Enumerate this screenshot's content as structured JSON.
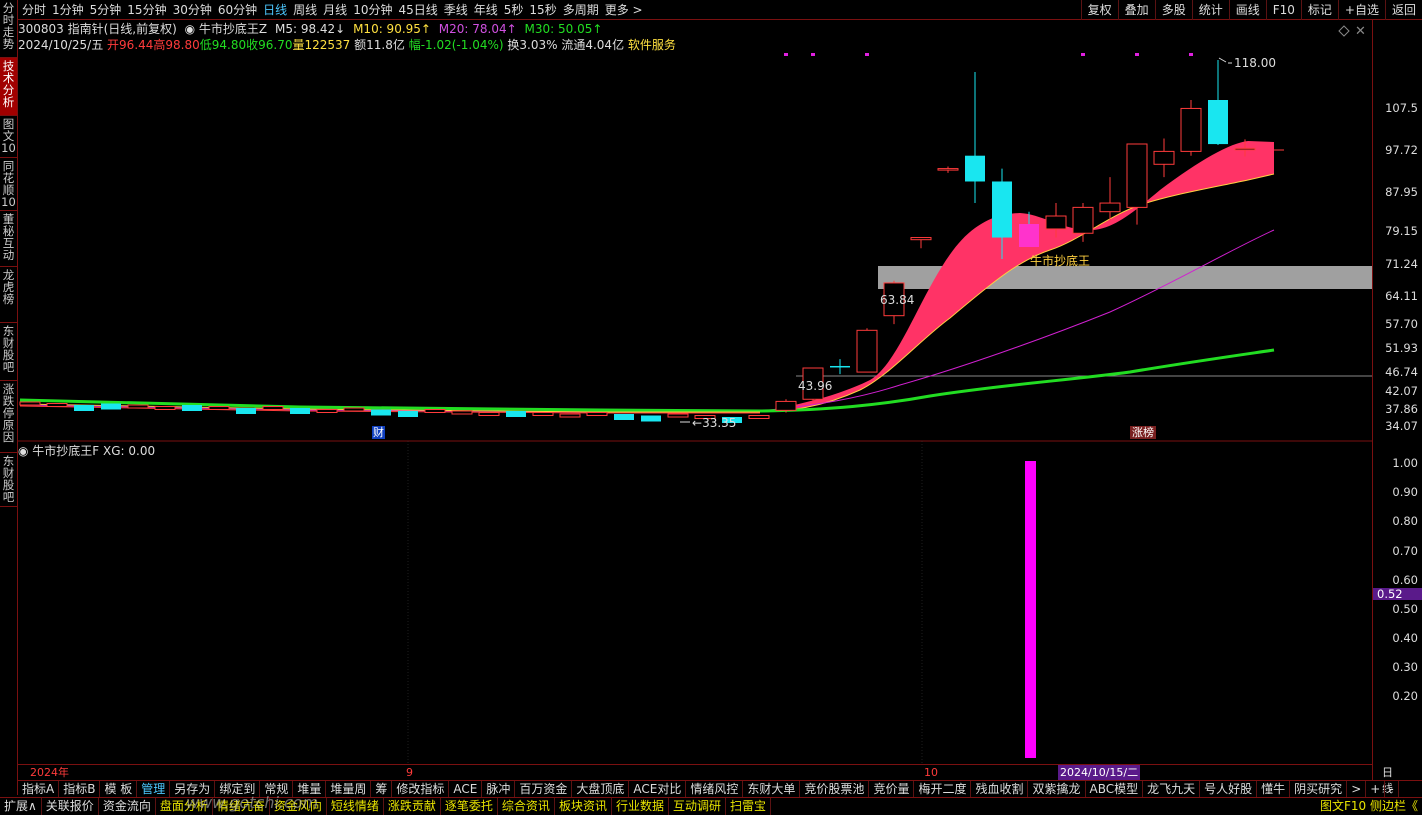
{
  "sidebar": [
    {
      "label": "分时走势",
      "active": false
    },
    {
      "label": "技术分析",
      "active": true
    },
    {
      "label": "图文10",
      "active": false
    },
    {
      "label": "同花顺10",
      "active": false
    },
    {
      "label": "董秘互动",
      "active": false
    },
    {
      "label": "龙虎榜",
      "active": false
    },
    {
      "label": "东财股吧",
      "active": false
    },
    {
      "label": "涨跌停原因",
      "active": false
    },
    {
      "label": "东财股吧",
      "active": false
    }
  ],
  "periods": [
    "分时",
    "1分钟",
    "5分钟",
    "15分钟",
    "30分钟",
    "60分钟",
    "日线",
    "周线",
    "月线",
    "10分钟",
    "45日线",
    "季线",
    "年线",
    "5秒",
    "15秒",
    "多周期",
    "更多 >"
  ],
  "active_period": "日线",
  "right_buttons": [
    "复权",
    "叠加",
    "多股",
    "统计",
    "画线",
    "F10",
    "标记",
    "+自选",
    "返回"
  ],
  "info": {
    "code_name": "300803 指南针(日线,前复权)",
    "indicator": "◉ 牛市抄底王Z",
    "m5": "M5: 98.42↓",
    "m10": "M10: 90.95↑",
    "m20": "M20: 78.04↑",
    "m30": "M30: 50.05↑",
    "date": "2024/10/25/五",
    "open": "开96.44",
    "high": "高98.80",
    "low": "低94.80",
    "close": "收96.70",
    "volume": "量122537",
    "amount": "额11.8亿",
    "change": "幅-1.02(-1.04%)",
    "turnover": "换3.03%",
    "float": "流通4.04亿",
    "sector": "软件服务"
  },
  "price_axis": [
    "107.5",
    "97.72",
    "87.95",
    "79.15",
    "71.24",
    "64.11",
    "57.70",
    "51.93",
    "46.74",
    "42.07",
    "37.86",
    "34.07"
  ],
  "annotations": {
    "high": "118.00",
    "low": "33.35",
    "p6384": "63.84",
    "p4396": "43.96",
    "signal": "牛市抄底王",
    "finance": "财",
    "limit": "涨榜"
  },
  "sub_header": "◉ 牛市抄底王F  XG: 0.00",
  "sub_axis": [
    "1.00",
    "0.90",
    "0.80",
    "0.70",
    "0.60",
    "0.50",
    "0.40",
    "0.30",
    "0.20"
  ],
  "sub_current": "0.52",
  "x_axis": {
    "year": "2024年",
    "m9": "9",
    "m10": "10",
    "cursor": "2024/10/15/二",
    "period": "日线"
  },
  "tabs": [
    "指标A",
    "指标B",
    "模 板",
    "管理",
    "另存为",
    "绑定到",
    "常规",
    "堆量",
    "堆量周",
    "筹",
    "修改指标",
    "ACE",
    "脉冲",
    "百万资金",
    "大盘顶底",
    "ACE对比",
    "情绪风控",
    "东财大单",
    "竞价股票池",
    "竞价量",
    "梅开二度",
    "残血收割",
    "双紫擒龙",
    "ABC模型",
    "龙飞九天",
    "号人好股",
    "懂牛",
    "阴买研究",
    ">",
    "+",
    "-"
  ],
  "active_tab": "管理",
  "bottom": [
    "扩展∧",
    "关联报价",
    "资金流向",
    "盘面分析",
    "情绪亢奋",
    "资金风向",
    "短线情绪",
    "涨跌贡献",
    "逐笔委托",
    "综合资讯",
    "板块资讯",
    "行业数据",
    "互动调研",
    "扫雷宝"
  ],
  "bottom_right": "图文F10 侧边栏《",
  "watermark": "www.gotchi.com",
  "colors": {
    "up": "#ff3b3b",
    "down": "#19e6f0",
    "ribbon": "#ff3366",
    "ma_green": "#22dd22",
    "ma_purple": "#d020d0",
    "signal_bar": "#ff00ff",
    "accent": "#4cc8ff"
  },
  "chart_data": {
    "type": "candlestick",
    "candles": [
      {
        "date": "2024-09-25",
        "open": 36.0,
        "high": 38.5,
        "low": 35.5,
        "close": 38.0
      },
      {
        "date": "2024-09-26",
        "open": 38.5,
        "high": 46.0,
        "low": 38.0,
        "close": 46.0
      },
      {
        "date": "2024-09-27",
        "open": 46.5,
        "high": 48.0,
        "low": 44.5,
        "close": 46.2
      },
      {
        "date": "2024-09-30",
        "open": 45.0,
        "high": 55.0,
        "low": 45.0,
        "close": 54.5
      },
      {
        "date": "2024-10-08",
        "open": 58.0,
        "high": 66.0,
        "low": 56.0,
        "close": 65.5
      },
      {
        "date": "2024-10-09",
        "open": 75.5,
        "high": 76.0,
        "low": 73.5,
        "close": 76.0
      },
      {
        "date": "2024-10-10",
        "open": 92.0,
        "high": 92.5,
        "low": 91.0,
        "close": 92.0
      },
      {
        "date": "2024-10-11",
        "open": 95.0,
        "high": 115.0,
        "low": 84.0,
        "close": 89.0
      },
      {
        "date": "2024-10-14",
        "open": 89.0,
        "high": 92.0,
        "low": 71.0,
        "close": 76.0
      },
      {
        "date": "2024-10-15",
        "open": 78.0,
        "high": 82.0,
        "low": 74.0,
        "close": 76.0
      },
      {
        "date": "2024-10-16",
        "open": 78.0,
        "high": 84.0,
        "low": 76.0,
        "close": 81.0
      },
      {
        "date": "2024-10-17",
        "open": 77.0,
        "high": 84.0,
        "low": 75.0,
        "close": 83.0
      },
      {
        "date": "2024-10-18",
        "open": 82.0,
        "high": 90.0,
        "low": 80.0,
        "close": 84.0
      },
      {
        "date": "2024-10-21",
        "open": 83.0,
        "high": 97.72,
        "low": 79.0,
        "close": 97.72
      },
      {
        "date": "2024-10-22",
        "open": 93.0,
        "high": 99.0,
        "low": 90.0,
        "close": 96.0
      },
      {
        "date": "2024-10-23",
        "open": 96.0,
        "high": 108.0,
        "low": 95.0,
        "close": 106.0
      },
      {
        "date": "2024-10-24",
        "open": 108.0,
        "high": 118.0,
        "low": 97.5,
        "close": 97.7
      },
      {
        "date": "2024-10-25",
        "open": 96.44,
        "high": 98.8,
        "low": 94.8,
        "close": 96.7
      }
    ],
    "ma": {
      "M5": 98.42,
      "M10": 90.95,
      "M20": 78.04,
      "M30": 50.05
    },
    "sub_series": {
      "name": "XG",
      "value_on_2024-10-15": 1.0
    },
    "y_range": [
      34.07,
      118.0
    ],
    "sub_y_range": [
      0,
      1.0
    ]
  }
}
